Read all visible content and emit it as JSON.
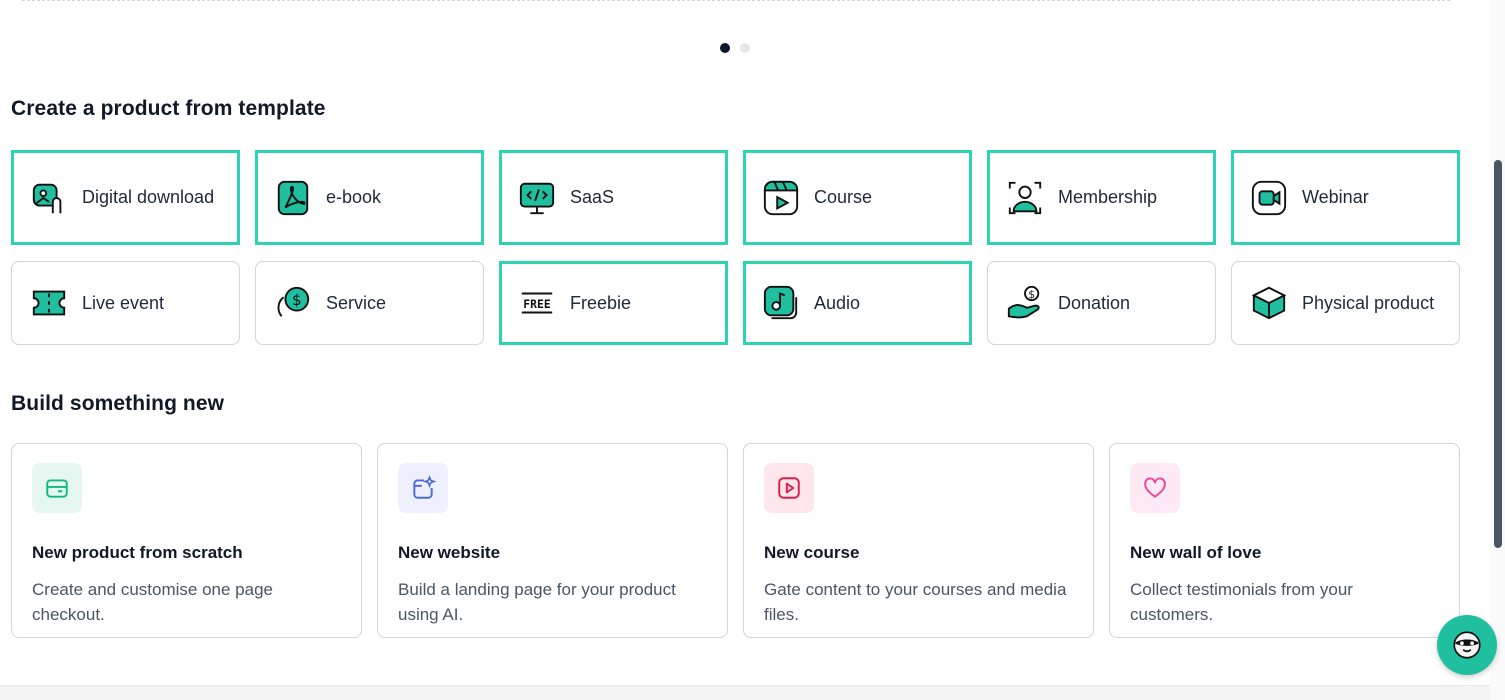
{
  "section_template": {
    "title": "Create a product from template"
  },
  "templates": [
    {
      "label": "Digital download",
      "icon": "digital-download-icon",
      "highlighted": true
    },
    {
      "label": "e-book",
      "icon": "pdf-icon",
      "highlighted": true
    },
    {
      "label": "SaaS",
      "icon": "code-monitor-icon",
      "highlighted": true
    },
    {
      "label": "Course",
      "icon": "video-course-icon",
      "highlighted": true
    },
    {
      "label": "Membership",
      "icon": "members-icon",
      "highlighted": true
    },
    {
      "label": "Webinar",
      "icon": "camera-icon",
      "highlighted": true
    },
    {
      "label": "Live event",
      "icon": "ticket-icon",
      "highlighted": false
    },
    {
      "label": "Service",
      "icon": "dollar-coin-icon",
      "highlighted": false
    },
    {
      "label": "Freebie",
      "icon": "free-tag-icon",
      "highlighted": true
    },
    {
      "label": "Audio",
      "icon": "music-note-icon",
      "highlighted": true
    },
    {
      "label": "Donation",
      "icon": "donation-hand-icon",
      "highlighted": false
    },
    {
      "label": "Physical product",
      "icon": "box-icon",
      "highlighted": false
    }
  ],
  "free_tag_text": "FREE",
  "section_build": {
    "title": "Build something new"
  },
  "build": [
    {
      "title": "New product from scratch",
      "desc": "Create and customise one page checkout.",
      "icon": "package-icon",
      "bg": "#e6f7f2",
      "fg": "#10b981"
    },
    {
      "title": "New website",
      "desc": "Build a landing page for your product using AI.",
      "icon": "sparkle-window-icon",
      "bg": "#eef0fd",
      "fg": "#4f6ad8"
    },
    {
      "title": "New course",
      "desc": "Gate content to your courses and media files.",
      "icon": "play-icon",
      "bg": "#fde7ec",
      "fg": "#e11d48"
    },
    {
      "title": "New wall of love",
      "desc": "Collect testimonials from your customers.",
      "icon": "heart-icon",
      "bg": "#fdeaf4",
      "fg": "#ec4899"
    }
  ],
  "colors": {
    "accent": "#2dd4b4",
    "icon_fill": "#1fbfa0",
    "dark": "#0f172a"
  }
}
